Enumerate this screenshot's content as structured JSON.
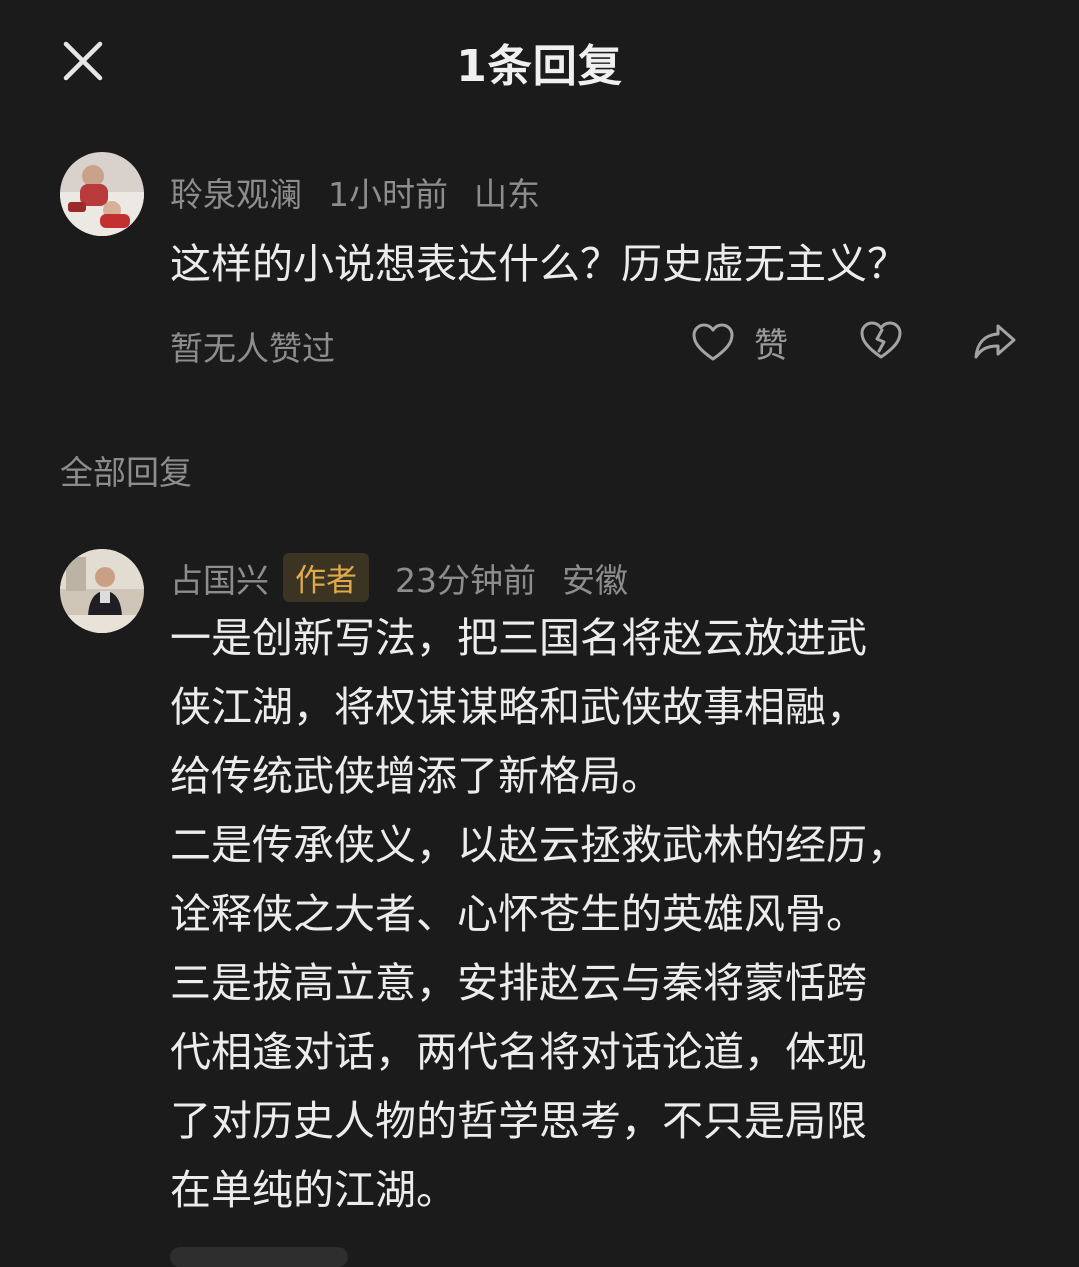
{
  "header": {
    "title": "1条回复",
    "close_icon": "close-icon"
  },
  "comment": {
    "username": "聆泉观澜",
    "time": "1小时前",
    "location": "山东",
    "text": "这样的小说想表达什么？历史虚无主义？",
    "likes_text": "暂无人赞过",
    "like_label": "赞",
    "icons": [
      "heart-icon",
      "broken-heart-icon",
      "share-icon"
    ]
  },
  "section": {
    "label": "全部回复"
  },
  "reply": {
    "username": "占国兴",
    "badge": "作者",
    "time": "23分钟前",
    "location": "安徽",
    "lines": [
      "一是创新写法，把三国名将赵云放进武",
      "侠江湖，将权谋谋略和武侠故事相融，",
      "给传统武侠增添了新格局。",
      "二是传承侠义，以赵云拯救武林的经历，",
      "诠释侠之大者、心怀苍生的英雄风骨。",
      "三是拔高立意，安排赵云与秦将蒙恬跨",
      "代相逢对话，两代名将对话论道，体现",
      "了对历史人物的哲学思考，不只是局限",
      "在单纯的江湖。"
    ]
  },
  "colors": {
    "background": "#1b1b1b",
    "text": "#ececec",
    "muted": "#8d8d8d",
    "badge_bg": "#3b3422",
    "badge_text": "#e0a94a"
  }
}
